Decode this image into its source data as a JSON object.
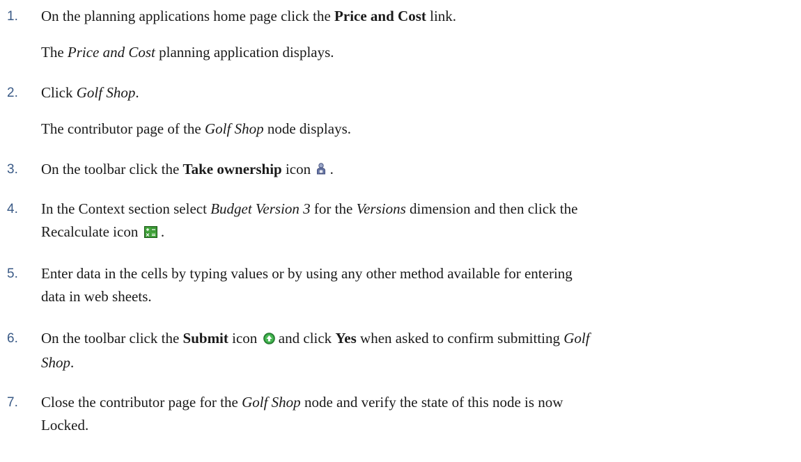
{
  "steps": [
    {
      "number": "1.",
      "parts": {
        "a": "On the planning applications home page click the ",
        "b": "Price and Cost",
        "c": " link."
      },
      "result": {
        "pre": "The ",
        "em": "Price and Cost",
        "post": " planning application displays."
      }
    },
    {
      "number": "2.",
      "parts": {
        "a": "Click ",
        "em": "Golf Shop",
        "c": "."
      },
      "result": {
        "pre": "The contributor page of the ",
        "em": "Golf Shop",
        "post": " node displays."
      }
    },
    {
      "number": "3.",
      "parts": {
        "a": "On the toolbar click the ",
        "b": "Take ownership",
        "c": " icon",
        "d": " ."
      },
      "icon": "take-ownership-icon"
    },
    {
      "number": "4.",
      "parts": {
        "a": "In the Context section select ",
        "em1": "Budget Version 3",
        "b": " for the ",
        "em2": "Versions",
        "c": " dimension and then click the",
        "d": "Recalculate icon",
        "e": " ."
      },
      "icon": "recalculate-icon"
    },
    {
      "number": "5.",
      "parts": {
        "line1": "Enter data in the cells by typing values or by using any other method available for entering",
        "line2": "data in web sheets."
      }
    },
    {
      "number": "6.",
      "parts": {
        "a": "On the toolbar click the ",
        "b1": "Submit",
        "c": " icon",
        "d": " and click ",
        "b2": "Yes",
        "e": " when asked to confirm submitting ",
        "em1": "Golf",
        "em2": "Shop",
        "f": "."
      },
      "icon": "submit-icon"
    },
    {
      "number": "7.",
      "parts": {
        "a": "Close the contributor page for the ",
        "em": "Golf Shop",
        "b": " node and verify the state of this node is now",
        "c": "Locked."
      }
    }
  ],
  "colors": {
    "step_number": "#3a5a86",
    "text": "#1a1a1a"
  }
}
